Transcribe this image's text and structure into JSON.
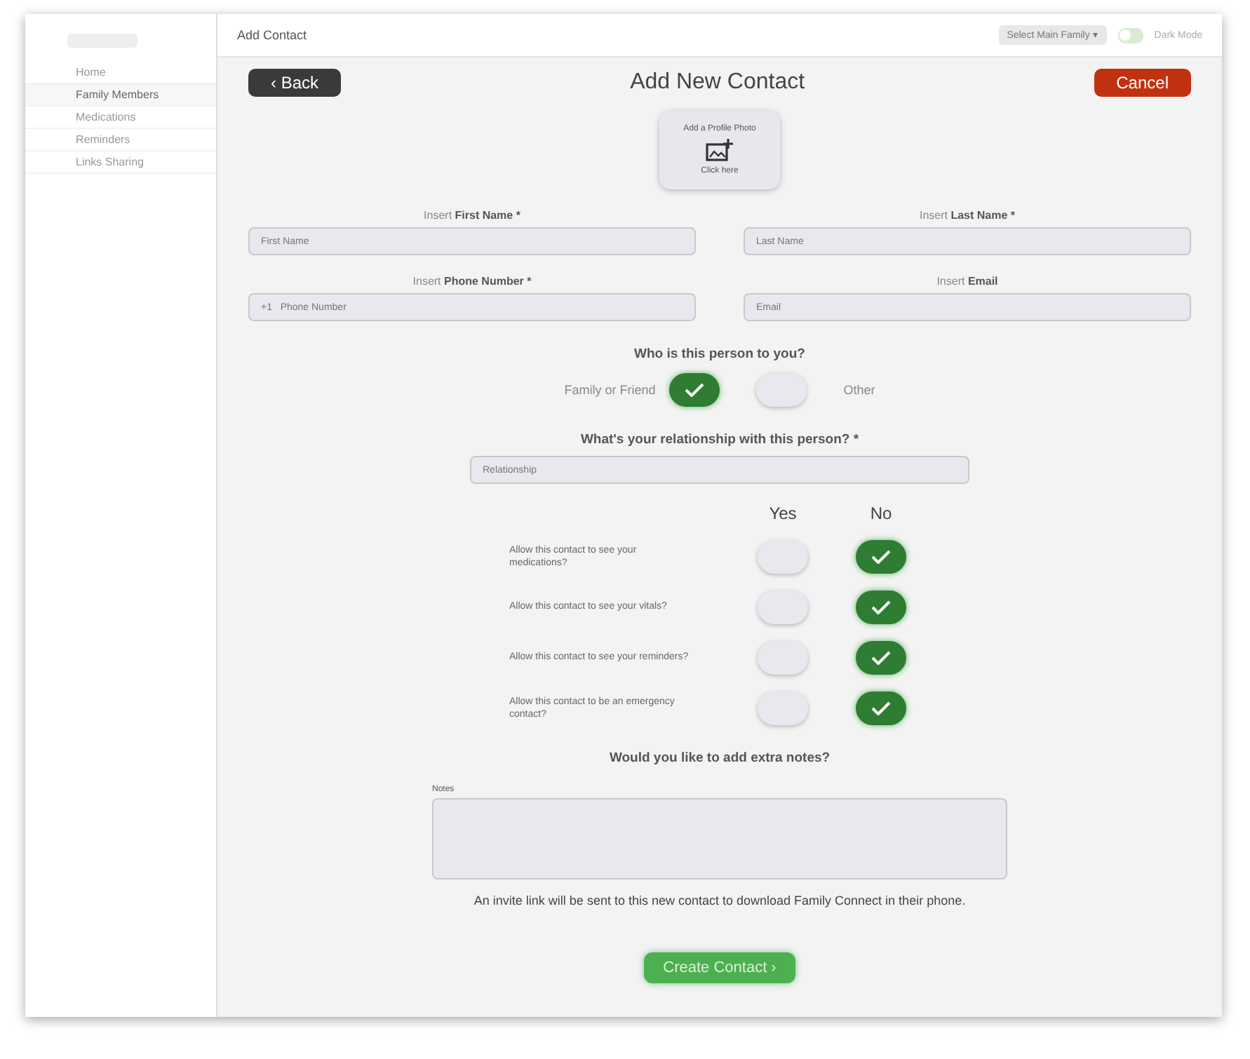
{
  "sidebar": {
    "items": [
      {
        "label": "Home",
        "selected": false
      },
      {
        "label": "Family Members",
        "selected": true
      },
      {
        "label": "Medications",
        "selected": false
      },
      {
        "label": "Reminders",
        "selected": false
      },
      {
        "label": "Links Sharing",
        "selected": false
      }
    ]
  },
  "header": {
    "title": "Add Contact",
    "dropdown": "Select Main Family ▾",
    "toggle_label": "Dark Mode",
    "toggle_on": false
  },
  "toolbar": {
    "back": "‹ Back",
    "title": "Add New Contact",
    "cancel": "Cancel"
  },
  "photo": {
    "title": "Add a Profile Photo",
    "hint": "Click here"
  },
  "fields": [
    {
      "prefix": "Insert ",
      "label": "First Name *",
      "placeholder": "First Name"
    },
    {
      "prefix": "Insert ",
      "label": "Last Name *",
      "placeholder": "Last Name"
    },
    {
      "prefix": "Insert ",
      "label": "Phone Number *",
      "placeholder": "+1   Phone Number"
    },
    {
      "prefix": "Insert ",
      "label": "Email",
      "placeholder": "Email"
    }
  ],
  "relation_type": {
    "question": "Who is this person to you?",
    "options": [
      {
        "label": "Family or Friend",
        "selected": true
      },
      {
        "label": "Other",
        "selected": false
      }
    ]
  },
  "relationship": {
    "question": "What's your relationship with this person? *",
    "placeholder": "Relationship"
  },
  "permissions": {
    "yes": "Yes",
    "no": "No",
    "rows": [
      {
        "label": "Allow this contact to see your medications?",
        "allowed": false
      },
      {
        "label": "Allow this contact to see your vitals?",
        "allowed": false
      },
      {
        "label": "Allow this contact to see your reminders?",
        "allowed": false
      },
      {
        "label": "Allow this contact to be an emergency contact?",
        "allowed": false
      }
    ]
  },
  "notes": {
    "question": "Would you like to add extra notes?",
    "label": "Notes"
  },
  "invite_text": "An invite link will be sent to this new contact to download Family Connect in their phone.",
  "submit": "Create Contact ›"
}
